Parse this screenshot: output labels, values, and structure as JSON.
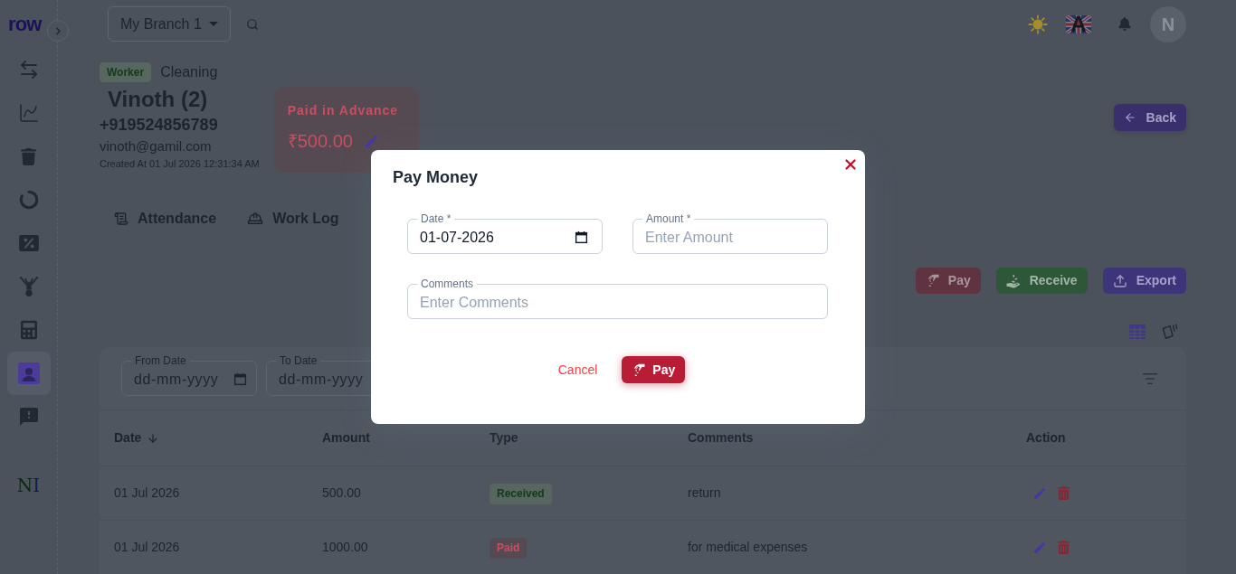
{
  "sidebar": {
    "logo": "row",
    "items": [
      {
        "kind": "transfer",
        "selected": false
      },
      {
        "kind": "chart",
        "selected": false
      },
      {
        "kind": "trash",
        "selected": false
      },
      {
        "kind": "ring",
        "selected": false
      },
      {
        "kind": "discount",
        "selected": false
      },
      {
        "kind": "sprout",
        "selected": false
      },
      {
        "kind": "calculator",
        "selected": false
      },
      {
        "kind": "contact",
        "selected": true
      },
      {
        "kind": "feedback",
        "selected": false
      }
    ],
    "footer_logo": [
      "N",
      "I"
    ]
  },
  "top_bar": {
    "branch": "My Branch 1",
    "language": "A",
    "avatar": "N"
  },
  "profile": {
    "role_badge": "Worker",
    "category": "Cleaning",
    "name": "Vinoth (2)",
    "phone": "+919524856789",
    "email": "vinoth@gamil.com",
    "created": "Created At 01 Jul 2026 12:31:34 AM",
    "balance_card": {
      "label": "Paid in Advance",
      "amount": "₹500.00"
    },
    "back_button": "Back"
  },
  "tabs": [
    {
      "kind": "attendance",
      "label": "Attendance",
      "selected": false
    },
    {
      "kind": "work_log",
      "label": "Work Log",
      "selected": false
    }
  ],
  "actions": [
    {
      "kind": "pay",
      "label": "Pay"
    },
    {
      "kind": "receive",
      "label": "Receive"
    },
    {
      "kind": "export",
      "label": "Export"
    }
  ],
  "view_toggle": [
    {
      "kind": "table",
      "selected": true
    },
    {
      "kind": "cards",
      "selected": false
    }
  ],
  "filters": [
    {
      "label": "From Date",
      "placeholder": "dd-mm-yyyy"
    },
    {
      "label": "To Date",
      "placeholder": "dd-mm-yyyy"
    }
  ],
  "table": {
    "columns": [
      {
        "label": "Date",
        "sorted": true
      },
      {
        "label": "Amount",
        "sorted": false
      },
      {
        "label": "Type",
        "sorted": false
      },
      {
        "label": "Comments",
        "sorted": false
      },
      {
        "label": "Action",
        "sorted": false
      }
    ],
    "rows": [
      {
        "date": "01 Jul 2026",
        "amount": "500.00",
        "type": {
          "kind": "received",
          "label": "Received"
        },
        "comments": "return"
      },
      {
        "date": "01 Jul 2026",
        "amount": "1000.00",
        "type": {
          "kind": "paid",
          "label": "Paid"
        },
        "comments": "for medical expenses"
      }
    ]
  },
  "modal": {
    "title": "Pay Money",
    "fields": [
      {
        "kind": "date",
        "label": "Date *",
        "value": "01-07-2026"
      },
      {
        "kind": "amount",
        "label": "Amount *",
        "placeholder": "Enter Amount"
      },
      {
        "kind": "comment",
        "label": "Comments",
        "placeholder": "Enter Comments"
      }
    ],
    "cancel": "Cancel",
    "submit": "Pay"
  }
}
